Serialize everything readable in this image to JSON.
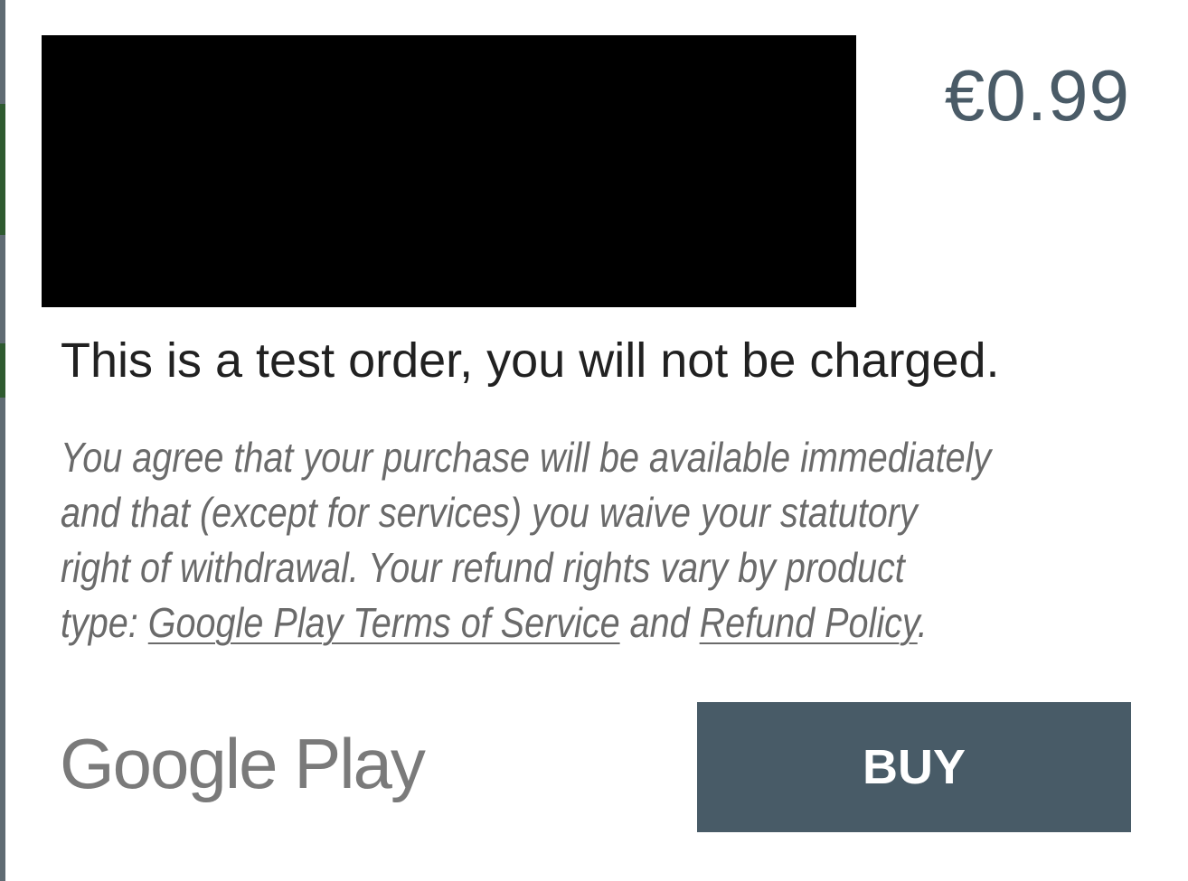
{
  "dialog": {
    "price": "€0.99",
    "test_notice": "This is a test order, you will not be charged.",
    "legal": {
      "line1": "You agree that your purchase will be available immediately",
      "line2": "and that (except for services) you waive your statutory",
      "line3": "right of withdrawal. Your refund rights vary by product",
      "line4_prefix": "type: ",
      "terms_link": "Google Play Terms of Service",
      "and_text": " and ",
      "refund_link": "Refund Policy",
      "period": "."
    },
    "brand": "Google Play",
    "buy_label": "BUY"
  },
  "colors": {
    "button_bg": "#485b67",
    "price": "#4a5b67",
    "product_image": "#000000"
  }
}
